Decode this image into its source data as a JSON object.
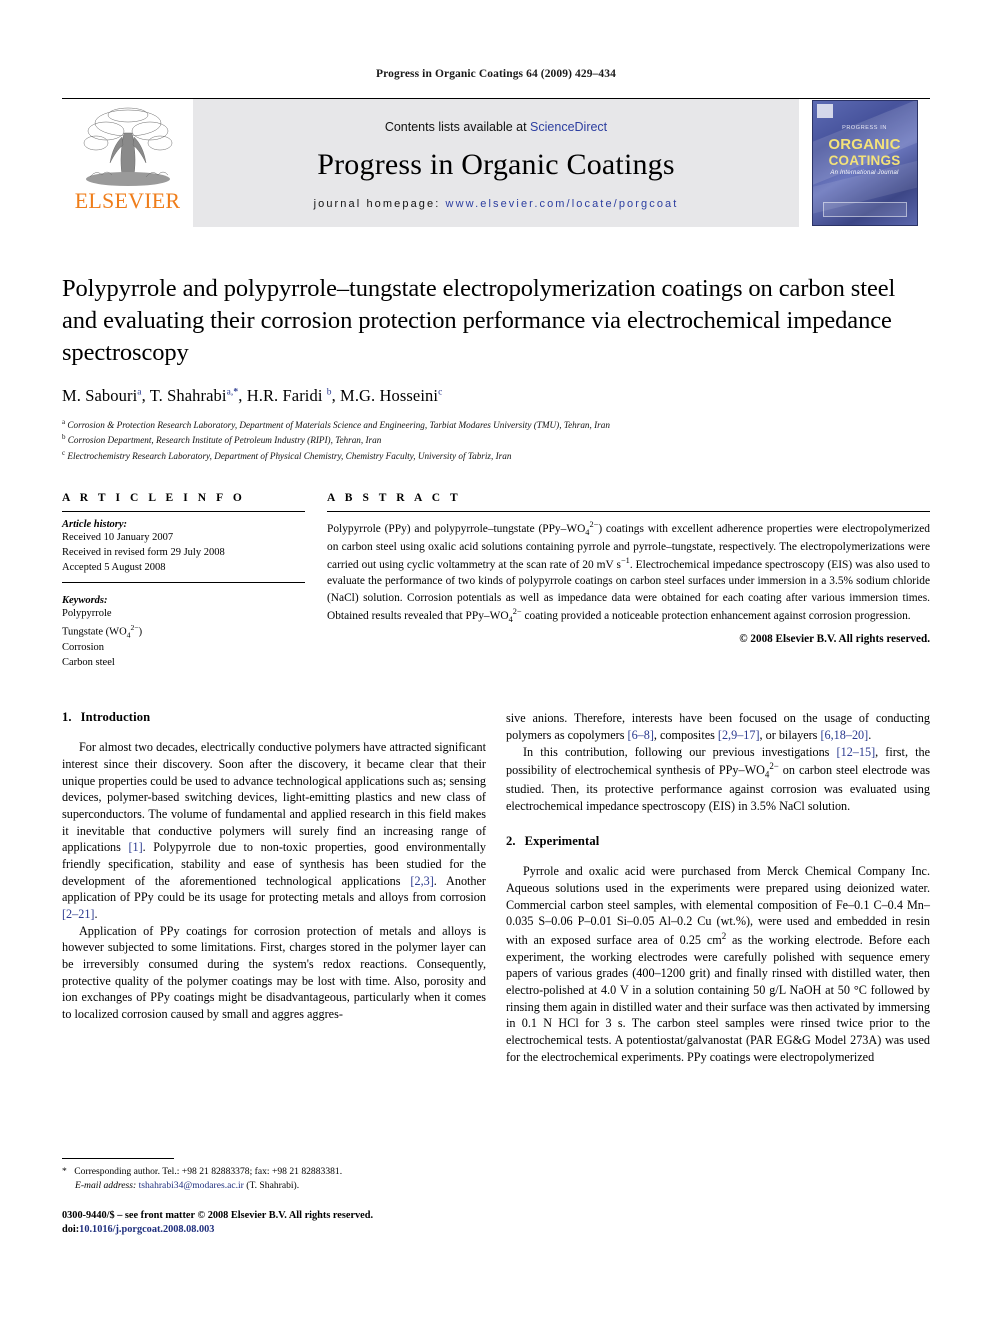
{
  "running_head": "Progress in Organic Coatings 64 (2009) 429–434",
  "masthead": {
    "publisher_name": "ELSEVIER",
    "contents_prefix": "Contents lists available at ",
    "contents_link": "ScienceDirect",
    "journal_name": "Progress in Organic Coatings",
    "homepage_prefix": "journal homepage:",
    "homepage_url": "www.elsevier.com/locate/porgcoat",
    "cover": {
      "kicker": "PROGRESS IN",
      "line1": "ORGANIC",
      "line2": "COATINGS",
      "subtitle": "An International Journal"
    }
  },
  "article": {
    "title": "Polypyrrole and polypyrrole–tungstate electropolymerization coatings on carbon steel and evaluating their corrosion protection performance via electrochemical impedance spectroscopy",
    "authors_html": "M. Sabouri<sup>a</sup>, T. Shahrabi<sup>a,<b>*</b></sup>, H.R. Faridi <sup>b</sup>, M.G. Hosseini<sup>c</sup>",
    "affiliations": [
      {
        "mark": "a",
        "text": "Corrosion & Protection Research Laboratory, Department of Materials Science and Engineering, Tarbiat Modares University (TMU), Tehran, Iran"
      },
      {
        "mark": "b",
        "text": "Corrosion Department, Research Institute of Petroleum Industry (RIPI), Tehran, Iran"
      },
      {
        "mark": "c",
        "text": "Electrochemistry Research Laboratory, Department of Physical Chemistry, Chemistry Faculty, University of Tabriz, Iran"
      }
    ]
  },
  "article_info": {
    "label": "A R T I C L E  I N F O",
    "history_title": "Article history:",
    "history": [
      "Received 10 January 2007",
      "Received in revised form 29 July 2008",
      "Accepted 5 August 2008"
    ],
    "keywords_title": "Keywords:",
    "keywords_html": [
      "Polypyrrole",
      "Tungstate (WO<sub>4</sub><sup>2−</sup>)",
      "Corrosion",
      "Carbon steel"
    ]
  },
  "abstract": {
    "label": "A B S T R A C T",
    "text_html": "Polypyrrole (PPy) and polypyrrole–tungstate (PPy–WO<sub>4</sub><sup>2−</sup>) coatings with excellent adherence properties were electropolymerized on carbon steel using oxalic acid solutions containing pyrrole and pyrrole–tungstate, respectively. The electropolymerizations were carried out using cyclic voltammetry at the scan rate of 20 mV s<sup>−1</sup>. Electrochemical impedance spectroscopy (EIS) was also used to evaluate the performance of two kinds of polypyrrole coatings on carbon steel surfaces under immersion in a 3.5% sodium chloride (NaCl) solution. Corrosion potentials as well as impedance data were obtained for each coating after various immersion times. Obtained results revealed that PPy–WO<sub>4</sub><sup>2−</sup> coating provided a noticeable protection enhancement against corrosion progression.",
    "copyright": "© 2008 Elsevier B.V. All rights reserved."
  },
  "sections": {
    "introduction": {
      "number": "1.",
      "title": "Introduction",
      "paragraphs_html": [
        "For almost two decades, electrically conductive polymers have attracted significant interest since their discovery. Soon after the discovery, it became clear that their unique properties could be used to advance technological applications such as; sensing devices, polymer-based switching devices, light-emitting plastics and new class of superconductors. The volume of fundamental and applied research in this field makes it inevitable that conductive polymers will surely find an increasing range of applications <span class=\"ref\">[1]</span>. Polypyrrole due to non-toxic properties, good environmentally friendly specification, stability and ease of synthesis has been studied for the development of the aforementioned technological applications <span class=\"ref\">[2,3]</span>. Another application of PPy could be its usage for protecting metals and alloys from corrosion <span class=\"ref\">[2–21]</span>.",
        "Application of PPy coatings for corrosion protection of metals and alloys is however subjected to some limitations. First, charges stored in the polymer layer can be irreversibly consumed during the system's redox reactions. Consequently, protective quality of the polymer coatings may be lost with time. Also, porosity and ion exchanges of PPy coatings might be disadvantageous, particularly when it comes to localized corrosion caused by small and aggressive anions. Therefore, interests have been focused on the usage of conducting polymers as copolymers <span class=\"ref\">[6–8]</span>, composites <span class=\"ref\">[2,9–17]</span>, or bilayers <span class=\"ref\">[6,18–20]</span>.",
        "In this contribution, following our previous investigations <span class=\"ref\">[12–15]</span>, first, the possibility of electrochemical synthesis of PPy–WO<sub>4</sub><sup>2−</sup> on carbon steel electrode was studied. Then, its protective performance against corrosion was evaluated using electrochemical impedance spectroscopy (EIS) in 3.5% NaCl solution."
      ]
    },
    "experimental": {
      "number": "2.",
      "title": "Experimental",
      "paragraphs_html": [
        "Pyrrole and oxalic acid were purchased from Merck Chemical Company Inc. Aqueous solutions used in the experiments were prepared using deionized water. Commercial carbon steel samples, with elemental composition of Fe–0.1 C–0.4 Mn–0.035 S–0.06 P–0.01 Si–0.05 Al–0.2 Cu (wt.%), were used and embedded in resin with an exposed surface area of 0.25 cm<sup>2</sup> as the working electrode. Before each experiment, the working electrodes were carefully polished with sequence emery papers of various grades (400–1200 grit) and finally rinsed with distilled water, then electro-polished at 4.0 V in a solution containing 50 g/L NaOH at 50 °C followed by rinsing them again in distilled water and their surface was then activated by immersing in 0.1 N HCl for 3 s. The carbon steel samples were rinsed twice prior to the electrochemical tests. A potentiostat/galvanostat (PAR EG&amp;G Model 273A) was used for the electrochemical experiments. PPy coatings were electropolymerized"
      ]
    }
  },
  "footnotes": {
    "corresponding_html": "<span class=\"star\">*</span> Corresponding author. Tel.: +98 21 82883378; fax: +98 21 82883381.",
    "email_label": "E-mail address:",
    "email": "tshahrabi34@modares.ac.ir",
    "email_owner": "(T. Shahrabi).",
    "issn_line": "0300-9440/$ – see front matter © 2008 Elsevier B.V. All rights reserved.",
    "doi_label": "doi:",
    "doi_value": "10.1016/j.porgcoat.2008.08.003"
  },
  "colors": {
    "elsevier_orange": "#ef7d1a",
    "link_blue": "#2c3ea0",
    "band_gray": "#e7e7e9"
  }
}
